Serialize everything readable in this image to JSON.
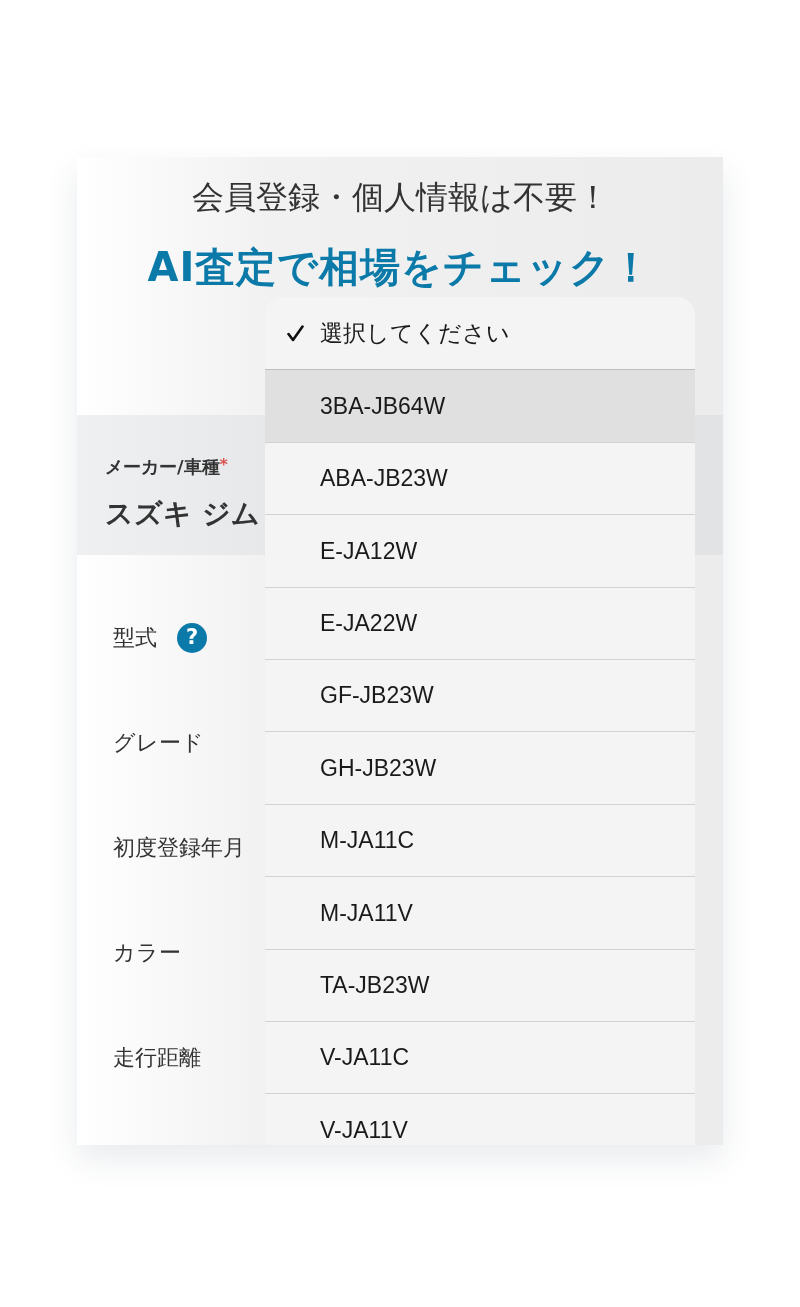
{
  "header": {
    "subtitle": "会員登録・個人情報は不要！",
    "headline": "AI査定で相場をチェック！"
  },
  "maker_field": {
    "label": "メーカー/車種",
    "required_mark": "*",
    "value": "スズキ ジム"
  },
  "form_rows": [
    {
      "label": "型式",
      "help_icon": "?"
    },
    {
      "label": "グレード"
    },
    {
      "label": "初度登録年月"
    },
    {
      "label": "カラー"
    },
    {
      "label": "走行距離"
    }
  ],
  "dropdown": {
    "options": [
      {
        "label": "選択してください",
        "checked": true,
        "highlighted": false
      },
      {
        "label": "3BA-JB64W",
        "checked": false,
        "highlighted": true
      },
      {
        "label": "ABA-JB23W",
        "checked": false,
        "highlighted": false
      },
      {
        "label": "E-JA12W",
        "checked": false,
        "highlighted": false
      },
      {
        "label": "E-JA22W",
        "checked": false,
        "highlighted": false
      },
      {
        "label": "GF-JB23W",
        "checked": false,
        "highlighted": false
      },
      {
        "label": "GH-JB23W",
        "checked": false,
        "highlighted": false
      },
      {
        "label": "M-JA11C",
        "checked": false,
        "highlighted": false
      },
      {
        "label": "M-JA11V",
        "checked": false,
        "highlighted": false
      },
      {
        "label": "TA-JB23W",
        "checked": false,
        "highlighted": false
      },
      {
        "label": "V-JA11C",
        "checked": false,
        "highlighted": false
      },
      {
        "label": "V-JA11V",
        "checked": false,
        "highlighted": false
      }
    ]
  }
}
